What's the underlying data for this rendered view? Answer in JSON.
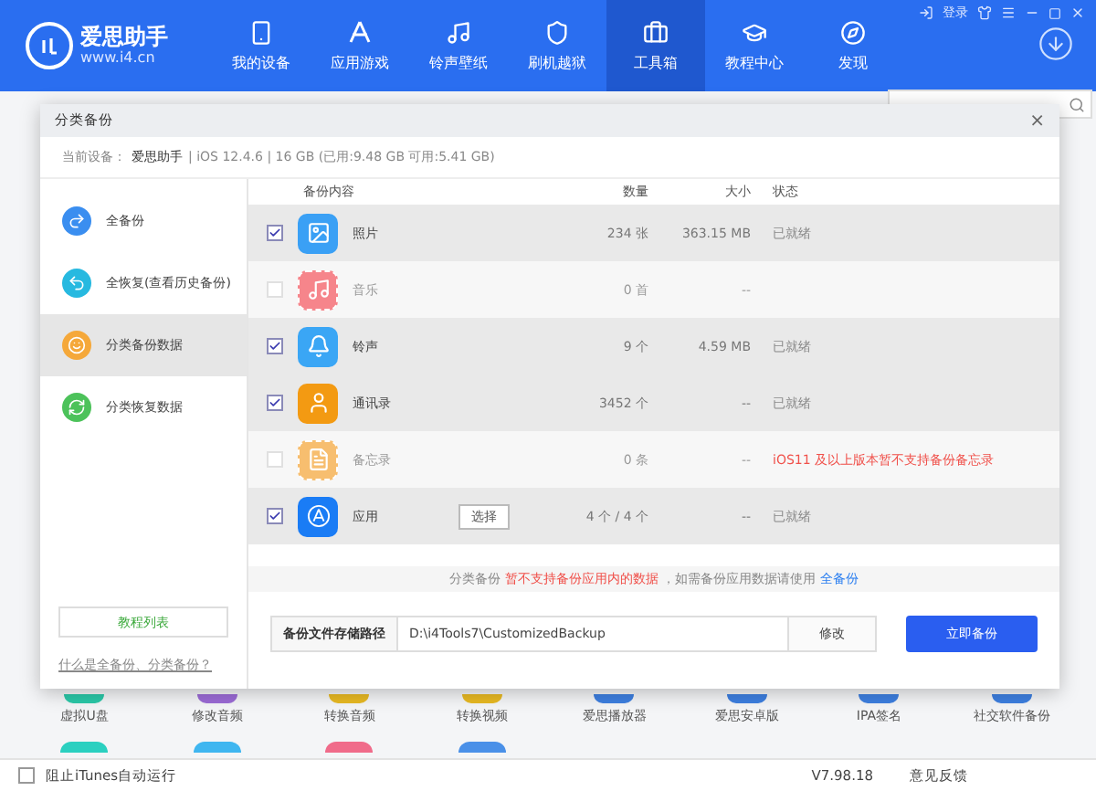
{
  "header": {
    "logo": {
      "name": "爱思助手",
      "url": "www.i4.cn"
    },
    "login": "登录",
    "nav": [
      {
        "label": "我的设备",
        "selected": false
      },
      {
        "label": "应用游戏",
        "selected": false
      },
      {
        "label": "铃声壁纸",
        "selected": false
      },
      {
        "label": "刷机越狱",
        "selected": false
      },
      {
        "label": "工具箱",
        "selected": true
      },
      {
        "label": "教程中心",
        "selected": false
      },
      {
        "label": "发现",
        "selected": false
      }
    ]
  },
  "tools": [
    {
      "label": "虚拟U盘",
      "color": "#2bc8a8"
    },
    {
      "label": "修改音频",
      "color": "#9b6bd6"
    },
    {
      "label": "转换音频",
      "color": "#e8b923"
    },
    {
      "label": "转换视频",
      "color": "#e8b923"
    },
    {
      "label": "爱思播放器",
      "color": "#3d7fe0"
    },
    {
      "label": "爱思安卓版",
      "color": "#3d7fe0"
    },
    {
      "label": "IPA签名",
      "color": "#3d7fe0"
    },
    {
      "label": "社交软件备份",
      "color": "#3d7fe0"
    }
  ],
  "tools_row2": [
    {
      "color": "#2bd0c0"
    },
    {
      "color": "#3fb6f0"
    },
    {
      "color": "#f06b8a"
    },
    {
      "color": "#4a90e8"
    }
  ],
  "dialog": {
    "title": "分类备份",
    "close": "×",
    "device": {
      "label": "当前设备：",
      "name": "爱思助手",
      "info": "|  iOS 12.4.6  |  16 GB (已用:9.48 GB 可用:5.41 GB)"
    },
    "menu": [
      {
        "label": "全备份",
        "color": "#3a8ef0",
        "selected": false
      },
      {
        "label": "全恢复(查看历史备份)",
        "color": "#27b9e0",
        "selected": false
      },
      {
        "label": "分类备份数据",
        "color": "#f5a83a",
        "selected": true
      },
      {
        "label": "分类恢复数据",
        "color": "#4cc25a",
        "selected": false
      }
    ],
    "tutorial_button": "教程列表",
    "help_link": "什么是全备份、分类备份？",
    "columns": [
      "备份内容",
      "数量",
      "大小",
      "状态"
    ],
    "rows": [
      {
        "name": "照片",
        "color": "#3aa0f5",
        "checked": true,
        "disabled": false,
        "count": "234 张",
        "size": "363.15 MB",
        "status": "已就绪"
      },
      {
        "name": "音乐",
        "color": "#f6858b",
        "checked": false,
        "disabled": true,
        "count": "0 首",
        "size": "--"
      },
      {
        "name": "铃声",
        "color": "#3aa6f5",
        "checked": true,
        "disabled": false,
        "count": "9 个",
        "size": "4.59 MB",
        "status": "已就绪"
      },
      {
        "name": "通讯录",
        "color": "#f39a12",
        "checked": true,
        "disabled": false,
        "count": "3452 个",
        "size": "--",
        "status": "已就绪"
      },
      {
        "name": "备忘录",
        "color": "#f7be6f",
        "checked": false,
        "disabled": true,
        "count": "0 条",
        "size": "--",
        "status": "iOS11 及以上版本暂不支持备份备忘录"
      },
      {
        "name": "应用",
        "color": "#1a7cf5",
        "checked": true,
        "disabled": false,
        "action": "选择",
        "count": "4 个 / 4 个",
        "size": "--",
        "status": "已就绪"
      }
    ],
    "notice": {
      "lead": "分类备份 ",
      "warning": "暂不支持备份应用内的数据",
      "rest": " ，如需备份应用数据请使用 ",
      "link": "全备份"
    },
    "path": {
      "label": "备份文件存储路径",
      "value": "D:\\i4Tools7\\CustomizedBackup",
      "modify": "修改",
      "backup": "立即备份"
    }
  },
  "status_bar": {
    "itunes": {
      "label": "阻止iTunes自动运行",
      "checked": false
    },
    "version": "V7.98.18",
    "feedback": "意见反馈"
  }
}
